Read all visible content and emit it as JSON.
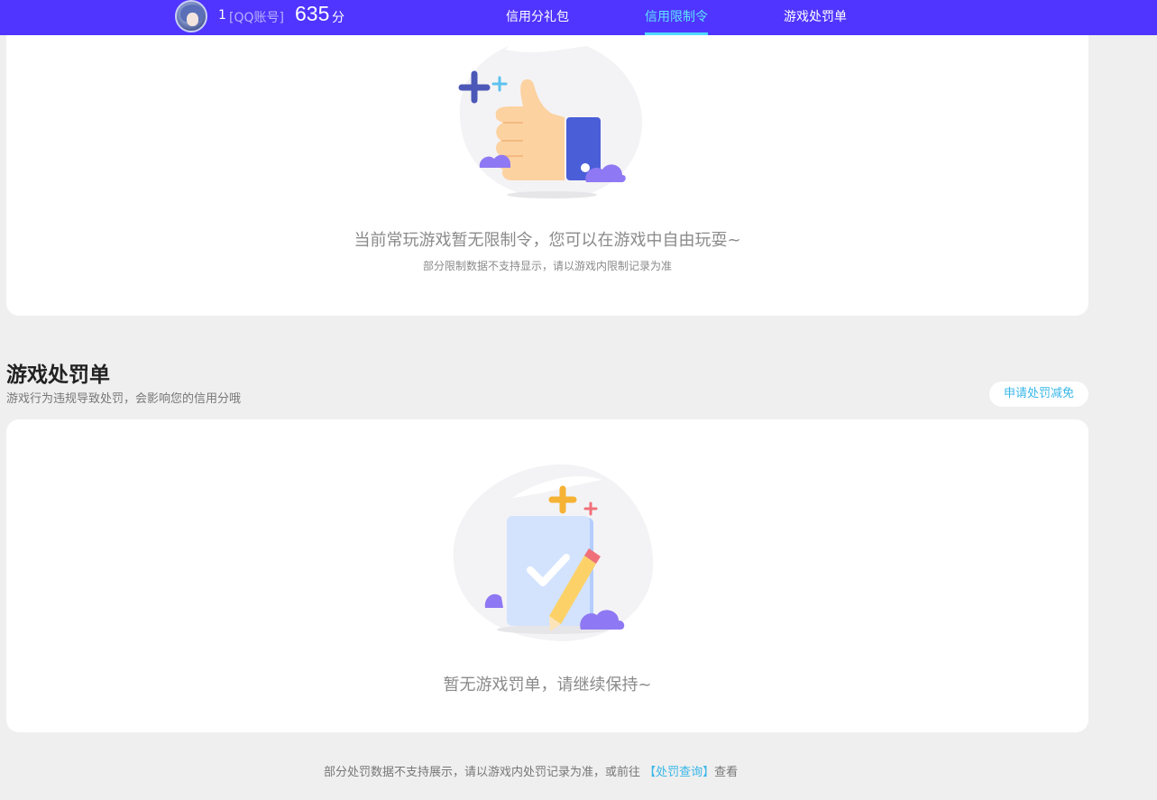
{
  "header": {
    "user_number": "1",
    "account_type": "[QQ账号]",
    "score": "635",
    "score_unit": "分",
    "tabs": [
      {
        "label": "信用分礼包",
        "active": false
      },
      {
        "label": "信用限制令",
        "active": true
      },
      {
        "label": "游戏处罚单",
        "active": false
      }
    ]
  },
  "restriction": {
    "message": "当前常玩游戏暂无限制令，您可以在游戏中自由玩耍~",
    "note": "部分限制数据不支持显示，请以游戏内限制记录为准"
  },
  "penalty": {
    "title": "游戏处罚单",
    "description": "游戏行为违规导致处罚，会影响您的信用分哦",
    "apply_button": "申请处罚减免",
    "message": "暂无游戏罚单，请继续保持~"
  },
  "footer": {
    "note_prefix": "部分处罚数据不支持展示，请以游戏内处罚记录为准，或前往 ",
    "link_label": "【处罚查询】",
    "note_suffix": "查看"
  },
  "colors": {
    "nav_bg": "#4f35ff",
    "active_tab": "#5fe6ff",
    "link": "#38b7e8",
    "page_bg": "#efefef"
  },
  "icons": {
    "illustration_1": "thumbs-up-illustration",
    "illustration_2": "checklist-pencil-illustration"
  }
}
